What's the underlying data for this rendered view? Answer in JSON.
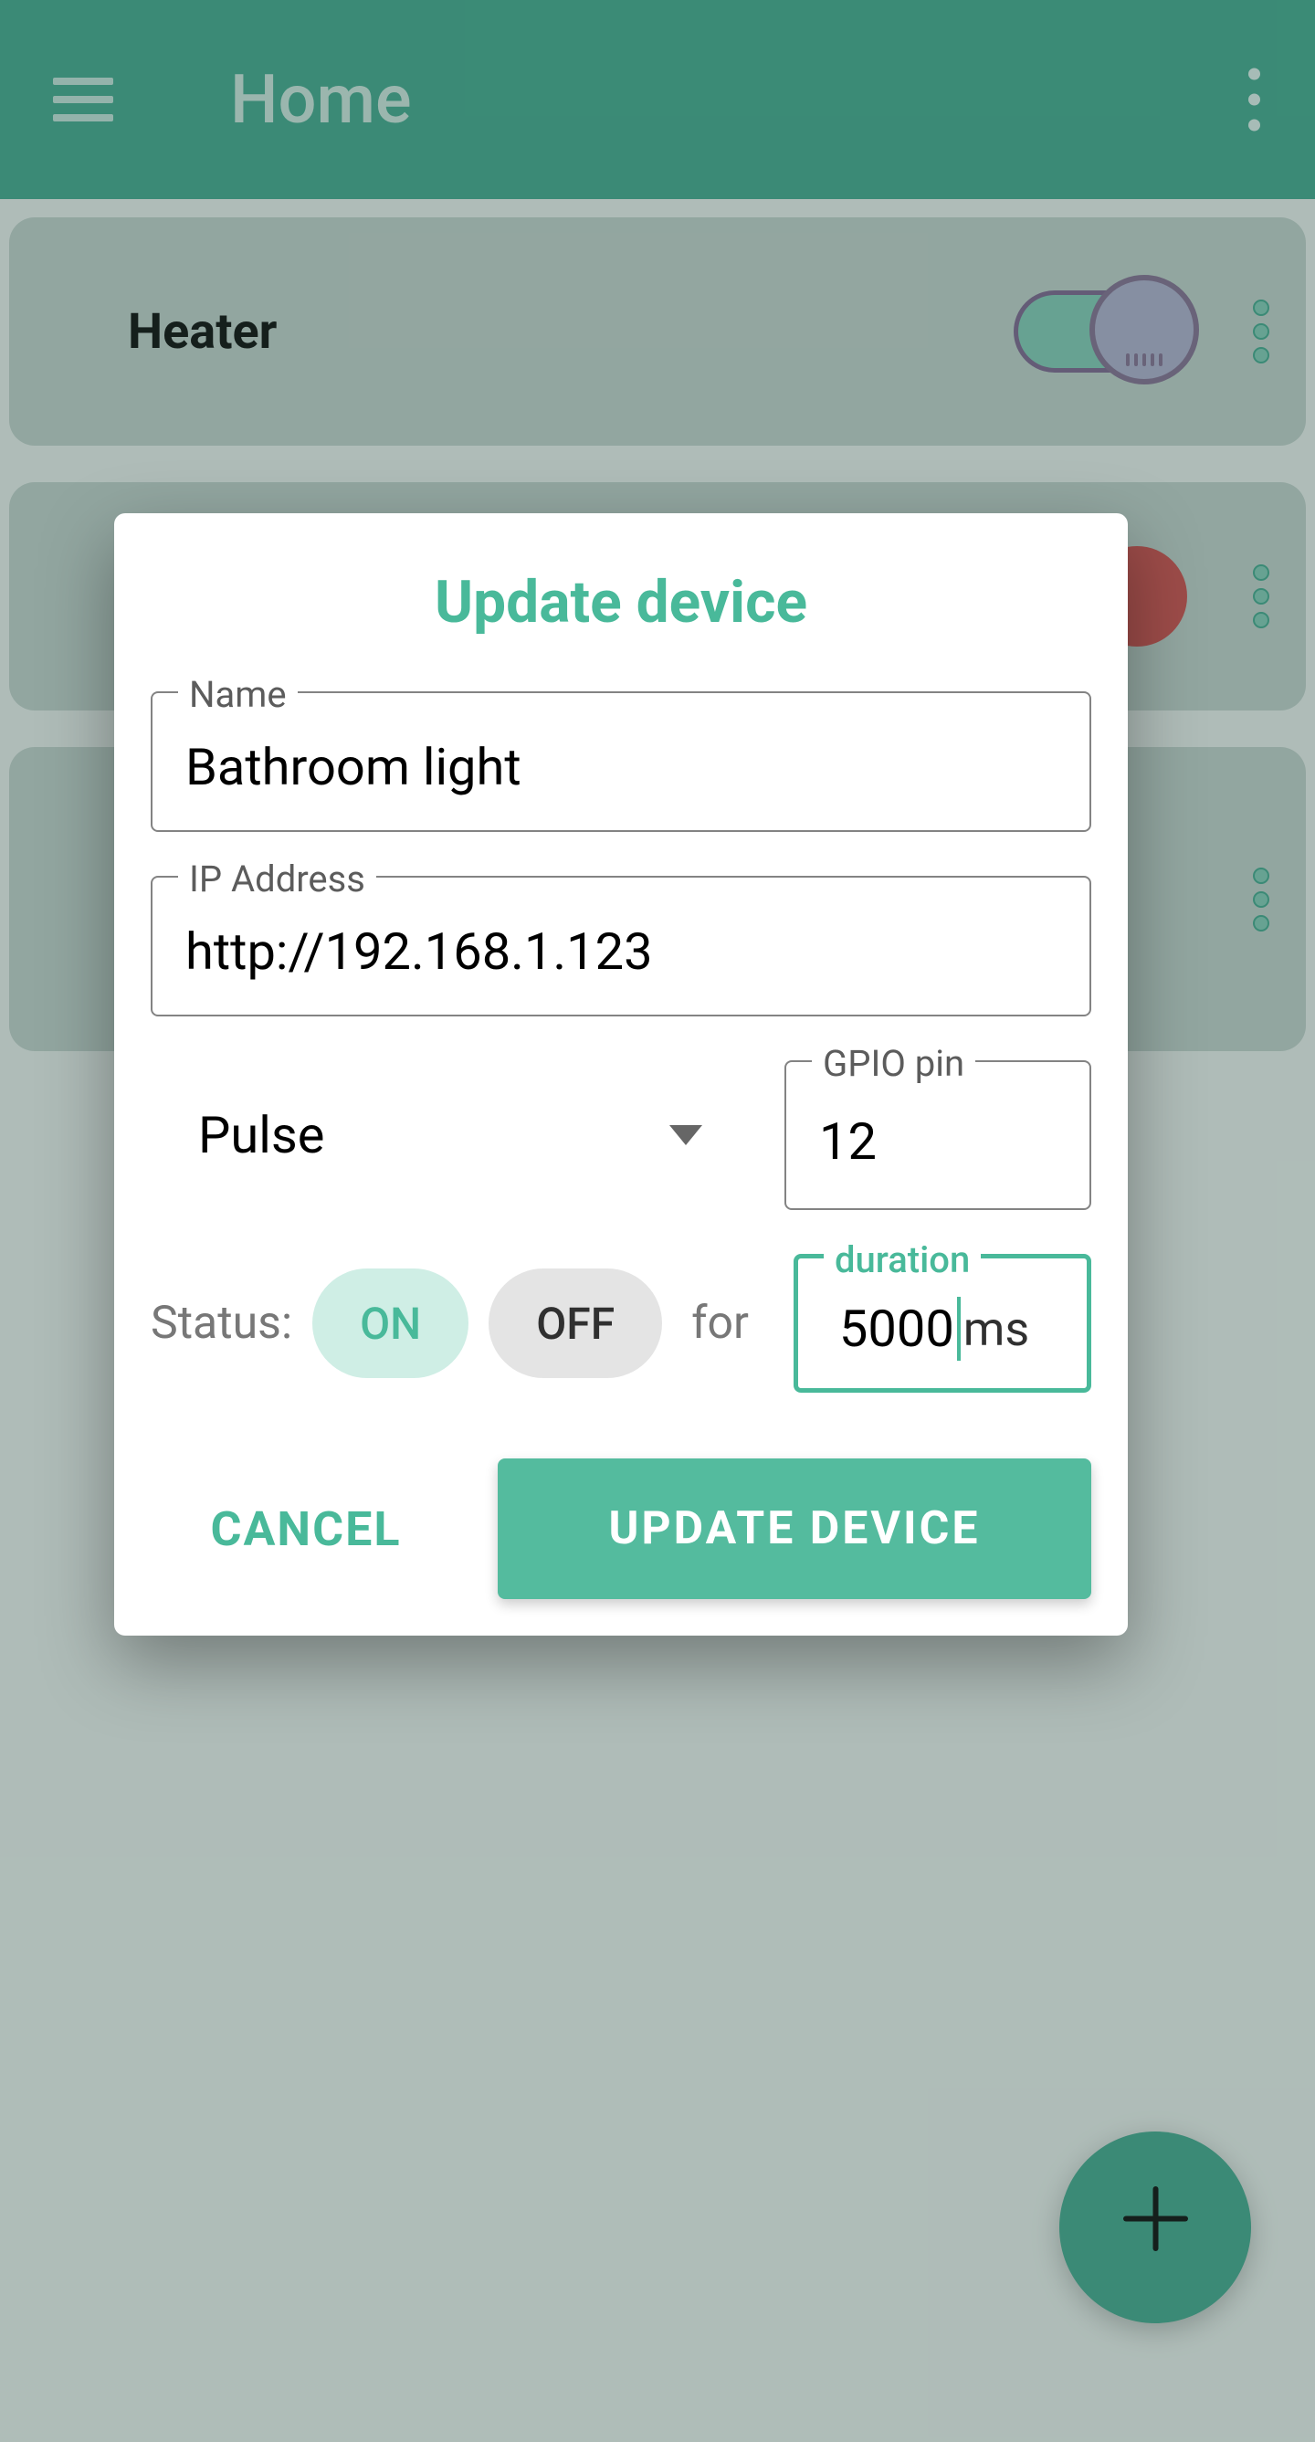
{
  "appBar": {
    "title": "Home"
  },
  "devices": [
    {
      "name": "Heater",
      "state": "on"
    },
    {
      "name": "",
      "state": "off"
    },
    {
      "name": "",
      "state": ""
    }
  ],
  "dialog": {
    "title": "Update device",
    "fields": {
      "nameLabel": "Name",
      "nameValue": "Bathroom light",
      "ipLabel": "IP Address",
      "ipValue": "http://192.168.1.123",
      "modeSelected": "Pulse",
      "gpioLabel": "GPIO pin",
      "gpioValue": "12",
      "statusLabel": "Status:",
      "onLabel": "ON",
      "offLabel": "OFF",
      "forLabel": "for",
      "durationLabel": "duration",
      "durationValue": "5000",
      "durationUnit": "ms"
    },
    "actions": {
      "cancel": "CANCEL",
      "submit": "UPDATE DEVICE"
    }
  },
  "fab": {
    "icon": "+"
  }
}
